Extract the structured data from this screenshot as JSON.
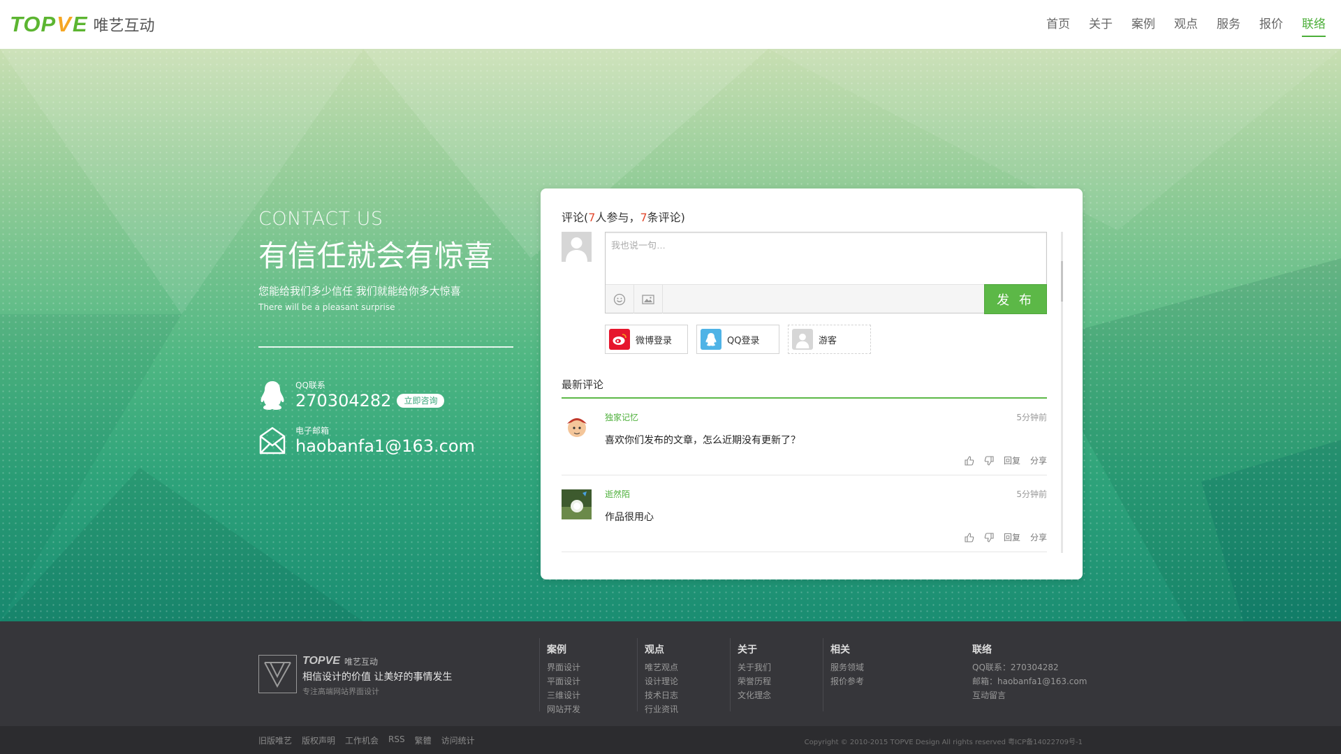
{
  "header": {
    "logo_en": "TOP",
    "logo_v": "V",
    "logo_e": "E",
    "logo_cn": "唯艺互动",
    "nav": [
      "首页",
      "关于",
      "案例",
      "观点",
      "服务",
      "报价",
      "联络"
    ],
    "active_index": 6
  },
  "contact": {
    "en_title": "CONTACT US",
    "title": "有信任就会有惊喜",
    "subtitle": "您能给我们多少信任 我们就能给你多大惊喜",
    "subtitle_en": "There will be a pleasant surprise",
    "qq_label": "QQ联系",
    "qq_value": "270304282",
    "consult": "立即咨询",
    "email_label": "电子邮箱",
    "email_value": "haobanfa1@163.com"
  },
  "comments": {
    "head_prefix": "评论(",
    "participants": "7",
    "head_mid": "人参与，",
    "count": "7",
    "head_suffix": "条评论)",
    "placeholder": "我也说一句…",
    "publish": "发 布",
    "login": [
      "微博登录",
      "QQ登录",
      "游客"
    ],
    "latest_title": "最新评论",
    "items": [
      {
        "name": "独家记忆",
        "time": "5分钟前",
        "text": "喜欢你们发布的文章，怎么近期没有更新了？",
        "reply": "回复",
        "share": "分享"
      },
      {
        "name": "逝然陌",
        "time": "5分钟前",
        "text": "作品很用心",
        "reply": "回复",
        "share": "分享"
      }
    ]
  },
  "footer": {
    "brand": "TOPVE",
    "brand_cn": "唯艺互动",
    "slogan": "相信设计的价值 让美好的事情发生",
    "tagline": "专注高端网站界面设计",
    "cols": [
      {
        "title": "案例",
        "links": [
          "界面设计",
          "平面设计",
          "三维设计",
          "网站开发"
        ]
      },
      {
        "title": "观点",
        "links": [
          "唯艺观点",
          "设计理论",
          "技术日志",
          "行业资讯"
        ]
      },
      {
        "title": "关于",
        "links": [
          "关于我们",
          "荣誉历程",
          "文化理念"
        ]
      },
      {
        "title": "相关",
        "links": [
          "服务领域",
          "报价参考"
        ]
      },
      {
        "title": "联络",
        "links": [
          "QQ联系：270304282",
          "邮箱：haobanfa1@163.com",
          "互动留言"
        ]
      }
    ],
    "bottom_links": [
      "旧版唯艺",
      "版权声明",
      "工作机会",
      "RSS",
      "繁體",
      "访问统计"
    ],
    "copyright": "Copyright © 2010-2015 TOPVE Design All rights reserved 粤ICP备14022709号-1"
  },
  "colors": {
    "accent": "#5cb847",
    "hero_top": "#c9dfb3",
    "hero_bottom": "#1a8d72",
    "footer": "#36363a"
  }
}
